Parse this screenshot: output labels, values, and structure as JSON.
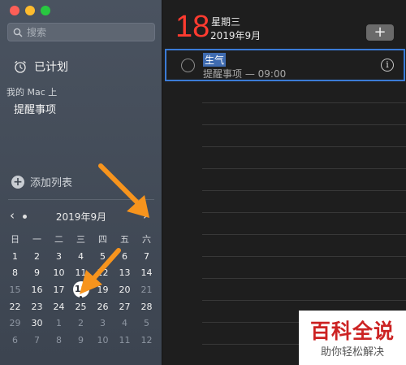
{
  "sidebar": {
    "search_placeholder": "搜索",
    "scheduled_label": "已计划",
    "section_label": "我的 Mac 上",
    "list_name": "提醒事项",
    "add_list_label": "添加列表"
  },
  "calendar": {
    "prev": "‹",
    "next": "›",
    "month_label": "2019年9月",
    "weekdays": [
      "日",
      "一",
      "二",
      "三",
      "四",
      "五",
      "六"
    ],
    "weeks": [
      [
        {
          "d": "1"
        },
        {
          "d": "2"
        },
        {
          "d": "3"
        },
        {
          "d": "4"
        },
        {
          "d": "5"
        },
        {
          "d": "6"
        },
        {
          "d": "7"
        }
      ],
      [
        {
          "d": "8"
        },
        {
          "d": "9"
        },
        {
          "d": "10"
        },
        {
          "d": "11"
        },
        {
          "d": "12"
        },
        {
          "d": "13"
        },
        {
          "d": "14"
        }
      ],
      [
        {
          "d": "15",
          "dim": true
        },
        {
          "d": "16"
        },
        {
          "d": "17"
        },
        {
          "d": "18",
          "today": true
        },
        {
          "d": "19"
        },
        {
          "d": "20"
        },
        {
          "d": "21",
          "dim": true
        }
      ],
      [
        {
          "d": "22"
        },
        {
          "d": "23"
        },
        {
          "d": "24"
        },
        {
          "d": "25"
        },
        {
          "d": "26"
        },
        {
          "d": "27"
        },
        {
          "d": "28"
        }
      ],
      [
        {
          "d": "29",
          "dim": true
        },
        {
          "d": "30"
        },
        {
          "d": "1",
          "dim": true
        },
        {
          "d": "2",
          "dim": true
        },
        {
          "d": "3",
          "dim": true
        },
        {
          "d": "4",
          "dim": true
        },
        {
          "d": "5",
          "dim": true
        }
      ],
      [
        {
          "d": "6",
          "dim": true
        },
        {
          "d": "7",
          "dim": true
        },
        {
          "d": "8",
          "dim": true
        },
        {
          "d": "9",
          "dim": true
        },
        {
          "d": "10",
          "dim": true
        },
        {
          "d": "11",
          "dim": true
        },
        {
          "d": "12",
          "dim": true
        }
      ]
    ]
  },
  "main": {
    "day_number": "18",
    "weekday": "星期三",
    "year_month": "2019年9月",
    "add_button": "+",
    "reminder": {
      "title": "生气",
      "meta": "提醒事项 — 09:00",
      "info": "i"
    }
  },
  "watermark": {
    "main": "百科全说",
    "sub": "助你轻松解决"
  },
  "colors": {
    "accent_red": "#ff3b30",
    "selection_blue": "#3b7bd6",
    "annotation_orange": "#f7941d"
  }
}
